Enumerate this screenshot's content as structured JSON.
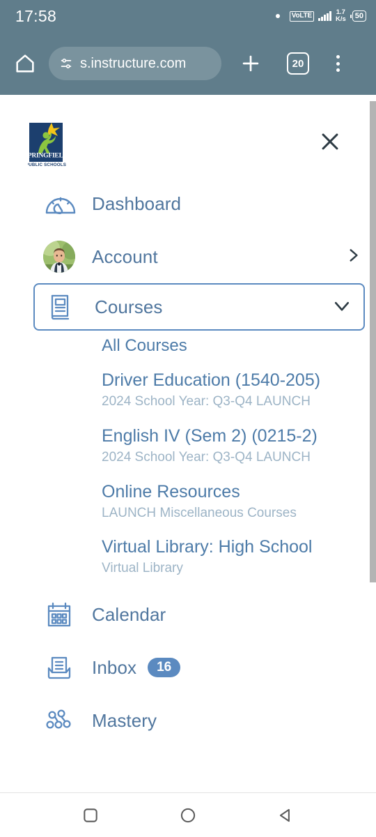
{
  "status_bar": {
    "clock": "17:58",
    "network_type": "VoLTE",
    "data_speed_value": "1.7",
    "data_speed_unit": "K/s",
    "battery_level": "50"
  },
  "browser": {
    "url": "s.instructure.com",
    "tab_count": "20",
    "home_icon": "home-icon",
    "site_settings_icon": "tune-icon",
    "new_tab_icon": "plus-icon",
    "menu_icon": "overflow-menu-icon"
  },
  "drawer": {
    "logo_alt": "Springfield Public Schools",
    "logo_line1": "SPRINGFIELD",
    "logo_line2": "PUBLIC SCHOOLS",
    "close_label": "Close",
    "items": [
      {
        "label": "Dashboard",
        "icon": "gauge-icon"
      },
      {
        "label": "Account",
        "icon": "avatar"
      },
      {
        "label": "Courses",
        "icon": "book-icon"
      },
      {
        "label": "Calendar",
        "icon": "calendar-icon"
      },
      {
        "label": "Inbox",
        "icon": "inbox-icon",
        "badge": "16"
      },
      {
        "label": "Mastery",
        "icon": "mastery-icon"
      }
    ],
    "courses": {
      "all_courses_label": "All Courses",
      "list": [
        {
          "title": "Driver Education (1540-205)",
          "subtitle": "2024 School Year: Q3-Q4 LAUNCH"
        },
        {
          "title": "English IV (Sem 2) (0215-2)",
          "subtitle": "2024 School Year: Q3-Q4 LAUNCH"
        },
        {
          "title": "Online Resources",
          "subtitle": "LAUNCH Miscellaneous Courses"
        },
        {
          "title": "Virtual Library: High School",
          "subtitle": "Virtual Library"
        }
      ]
    }
  },
  "android_nav": {
    "recents_label": "Recent apps",
    "home_label": "Home",
    "back_label": "Back"
  },
  "colors": {
    "chrome_bg": "#607d8b",
    "link_blue": "#4d7ba8",
    "icon_blue": "#5b8ac0",
    "muted": "#9db4c6",
    "badge_bg": "#5b8ac0"
  }
}
